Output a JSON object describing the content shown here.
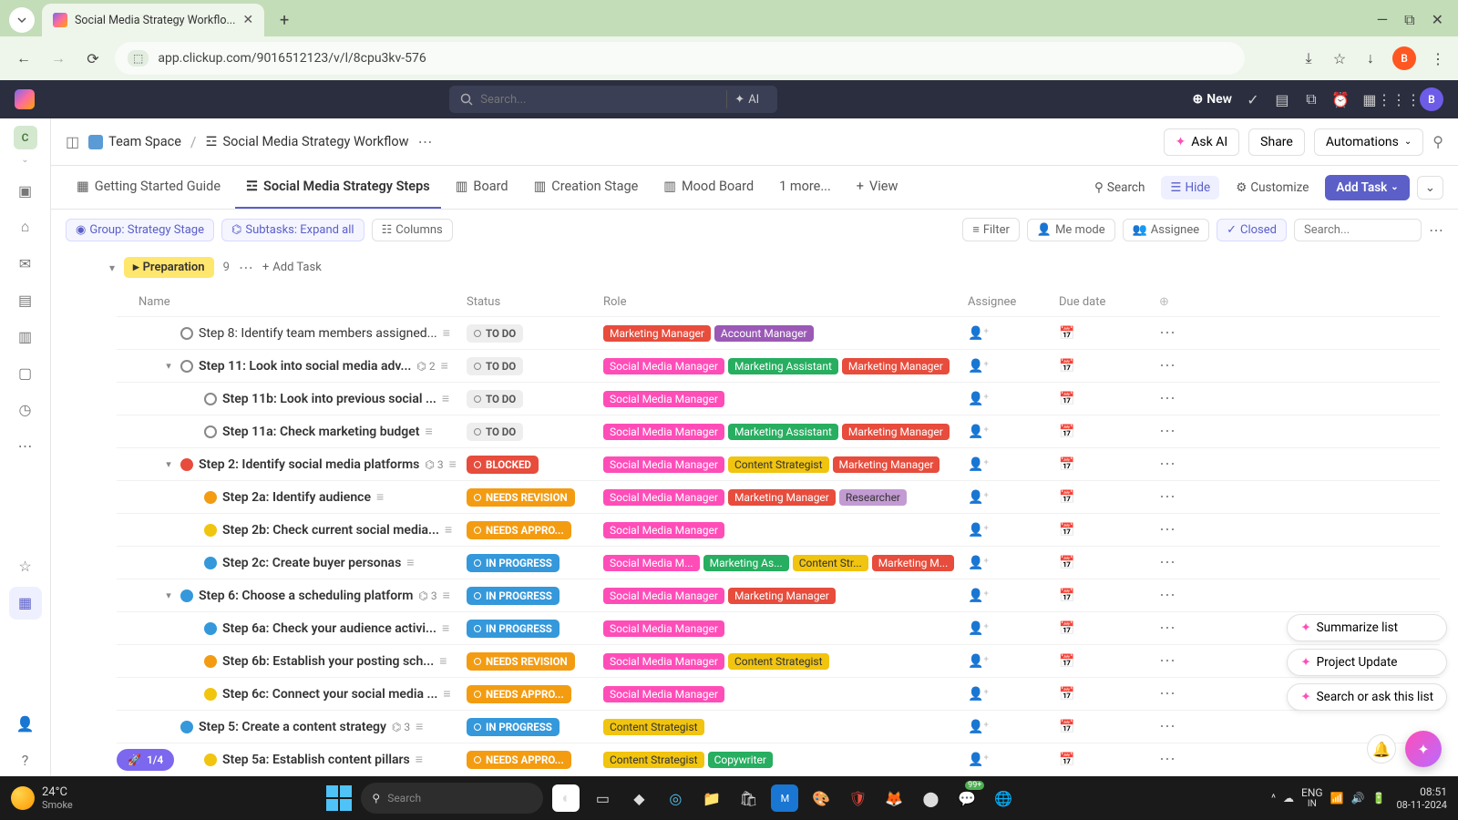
{
  "browser": {
    "tab_title": "Social Media Strategy Workflo...",
    "url": "app.clickup.com/9016512123/v/l/8cpu3kv-576",
    "profile_letter": "B"
  },
  "topbar": {
    "search_placeholder": "Search...",
    "ai_label": "AI",
    "new_label": "New",
    "avatar_letter": "B"
  },
  "workspace_letter": "C",
  "breadcrumb": {
    "space": "Team Space",
    "list": "Social Media Strategy Workflow"
  },
  "header_actions": {
    "ask_ai": "Ask AI",
    "share": "Share",
    "automations": "Automations"
  },
  "views": {
    "tabs": [
      {
        "label": "Getting Started Guide"
      },
      {
        "label": "Social Media Strategy Steps"
      },
      {
        "label": "Board"
      },
      {
        "label": "Creation Stage"
      },
      {
        "label": "Mood Board"
      }
    ],
    "more": "1 more...",
    "add_view": "View",
    "search": "Search",
    "hide": "Hide",
    "customize": "Customize",
    "add_task": "Add Task"
  },
  "filters": {
    "group": "Group: Strategy Stage",
    "subtasks": "Subtasks: Expand all",
    "columns": "Columns",
    "filter": "Filter",
    "me_mode": "Me mode",
    "assignee": "Assignee",
    "closed": "Closed",
    "search_placeholder": "Search..."
  },
  "group": {
    "name": "Preparation",
    "count": "9",
    "add_task": "Add Task"
  },
  "columns": {
    "name": "Name",
    "status": "Status",
    "role": "Role",
    "assignee": "Assignee",
    "due": "Due date"
  },
  "statuses": {
    "todo": "TO DO",
    "blocked": "BLOCKED",
    "revision": "NEEDS REVISION",
    "approval": "NEEDS APPRO...",
    "progress": "IN PROGRESS"
  },
  "role_labels": {
    "mm": "Marketing Manager",
    "am": "Account Manager",
    "smm": "Social Media Manager",
    "ma": "Marketing Assistant",
    "cs": "Content Strategist",
    "res": "Researcher",
    "cw": "Copywriter",
    "smm_s": "Social Media M...",
    "ma_s": "Marketing As...",
    "cs_s": "Content Str...",
    "mm_s": "Marketing M..."
  },
  "tasks": [
    {
      "title": "Step 8: Identify team members assigned...",
      "status": "todo",
      "dot": "gray",
      "indent": 1,
      "roles": [
        [
          "mm",
          "red"
        ],
        [
          "am",
          "purple"
        ]
      ],
      "bold": false
    },
    {
      "title": "Step 11: Look into social media adv...",
      "status": "todo",
      "dot": "gray",
      "indent": 1,
      "caret": true,
      "sub": "2",
      "roles": [
        [
          "smm",
          "pink"
        ],
        [
          "ma",
          "green"
        ],
        [
          "mm",
          "red"
        ]
      ],
      "bold": true
    },
    {
      "title": "Step 11b: Look into previous social ...",
      "status": "todo",
      "dot": "gray",
      "indent": 2,
      "roles": [
        [
          "smm",
          "pink"
        ]
      ],
      "bold": true
    },
    {
      "title": "Step 11a: Check marketing budget",
      "status": "todo",
      "dot": "gray",
      "indent": 2,
      "roles": [
        [
          "smm",
          "pink"
        ],
        [
          "ma",
          "green"
        ],
        [
          "mm",
          "red"
        ]
      ],
      "bold": true
    },
    {
      "title": "Step 2: Identify social media platforms",
      "status": "blocked",
      "dot": "red",
      "indent": 1,
      "caret": true,
      "sub": "3",
      "roles": [
        [
          "smm",
          "pink"
        ],
        [
          "cs",
          "yellow"
        ],
        [
          "mm",
          "red"
        ]
      ],
      "bold": true
    },
    {
      "title": "Step 2a: Identify audience",
      "status": "revision",
      "dot": "orange",
      "indent": 2,
      "roles": [
        [
          "smm",
          "pink"
        ],
        [
          "mm",
          "red"
        ],
        [
          "res",
          "lpurple"
        ]
      ],
      "bold": true
    },
    {
      "title": "Step 2b: Check current social media...",
      "status": "approval",
      "dot": "yellow",
      "indent": 2,
      "roles": [
        [
          "smm",
          "pink"
        ]
      ],
      "bold": true
    },
    {
      "title": "Step 2c: Create buyer personas",
      "status": "progress",
      "dot": "blue",
      "indent": 2,
      "roles": [
        [
          "smm_s",
          "pink"
        ],
        [
          "ma_s",
          "green"
        ],
        [
          "cs_s",
          "yellow"
        ],
        [
          "mm_s",
          "red"
        ]
      ],
      "bold": true
    },
    {
      "title": "Step 6: Choose a scheduling platform",
      "status": "progress",
      "dot": "blue",
      "indent": 1,
      "caret": true,
      "sub": "3",
      "roles": [
        [
          "smm",
          "pink"
        ],
        [
          "mm",
          "red"
        ]
      ],
      "bold": true
    },
    {
      "title": "Step 6a: Check your audience activi...",
      "status": "progress",
      "dot": "blue",
      "indent": 2,
      "roles": [
        [
          "smm",
          "pink"
        ]
      ],
      "bold": true
    },
    {
      "title": "Step 6b: Establish your posting sch...",
      "status": "revision",
      "dot": "orange",
      "indent": 2,
      "roles": [
        [
          "smm",
          "pink"
        ],
        [
          "cs",
          "yellow"
        ]
      ],
      "bold": true
    },
    {
      "title": "Step 6c: Connect your social media ...",
      "status": "approval",
      "dot": "yellow",
      "indent": 2,
      "roles": [
        [
          "smm",
          "pink"
        ]
      ],
      "bold": true
    },
    {
      "title": "Step 5: Create a content strategy",
      "status": "progress",
      "dot": "blue",
      "indent": 1,
      "caret": false,
      "sub": "3",
      "roles": [
        [
          "cs",
          "yellow"
        ]
      ],
      "bold": true
    },
    {
      "title": "Step 5a: Establish content pillars",
      "status": "approval",
      "dot": "yellow",
      "indent": 2,
      "roles": [
        [
          "cs",
          "yellow"
        ],
        [
          "cw",
          "green"
        ]
      ],
      "bold": true
    }
  ],
  "float": {
    "summarize": "Summarize list",
    "update": "Project Update",
    "search": "Search or ask this list"
  },
  "progress_badge": "1/4",
  "taskbar": {
    "temp": "24°C",
    "cond": "Smoke",
    "search": "Search",
    "lang1": "ENG",
    "lang2": "IN",
    "time": "08:51",
    "date": "08-11-2024",
    "wa_badge": "99+"
  }
}
